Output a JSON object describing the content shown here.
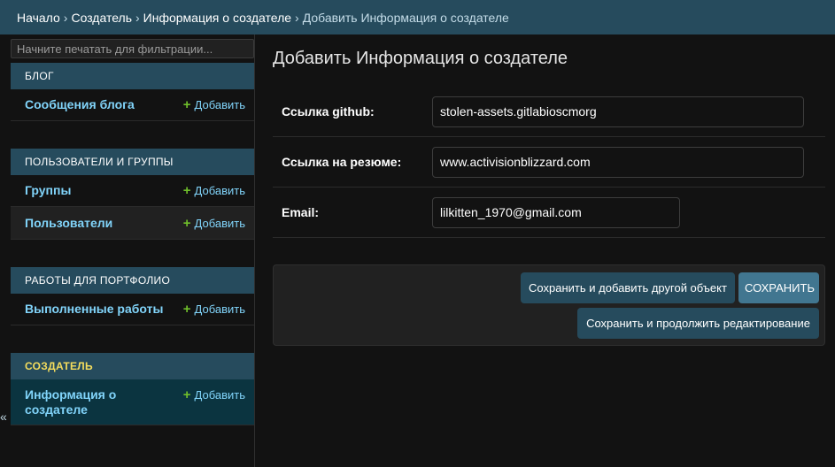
{
  "breadcrumbs": {
    "home": "Начало",
    "sep": "›",
    "app": "Создатель",
    "model": "Информация о создателе",
    "current": "Добавить Информация о создателе"
  },
  "sidebar": {
    "filter_placeholder": "Начните печатать для фильтрации...",
    "add_label": "Добавить",
    "modules": [
      {
        "caption": "БЛОГ",
        "models": [
          "Сообщения блога"
        ]
      },
      {
        "caption": "ПОЛЬЗОВАТЕЛИ И ГРУППЫ",
        "models": [
          "Группы",
          "Пользователи"
        ]
      },
      {
        "caption": "РАБОТЫ ДЛЯ ПОРТФОЛИО",
        "models": [
          "Выполненные работы"
        ]
      },
      {
        "caption": "СОЗДАТЕЛЬ",
        "models": [
          "Информация о создателе"
        ]
      }
    ],
    "collapse_glyph": "«"
  },
  "content": {
    "title": "Добавить Информация о создателе",
    "fields": [
      {
        "label": "Ссылка github:",
        "value": "stolen-assets.gitlabioscmorg"
      },
      {
        "label": "Ссылка на резюме:",
        "value": "www.activisionblizzard.com"
      },
      {
        "label": "Email:",
        "value": "lilkitten_1970@gmail.com"
      }
    ],
    "buttons": {
      "save_add_another": "Сохранить и добавить другой объект",
      "save": "СОХРАНИТЬ",
      "save_continue": "Сохранить и продолжить редактирование"
    }
  },
  "colors": {
    "header_bg": "#264b5d",
    "link": "#81d4fa",
    "add_plus": "#70bf2b",
    "active_caption": "#f5dd5d",
    "default_button": "#417690"
  },
  "icons": {
    "add": "plus-icon",
    "collapse": "collapse-sidebar-icon"
  }
}
